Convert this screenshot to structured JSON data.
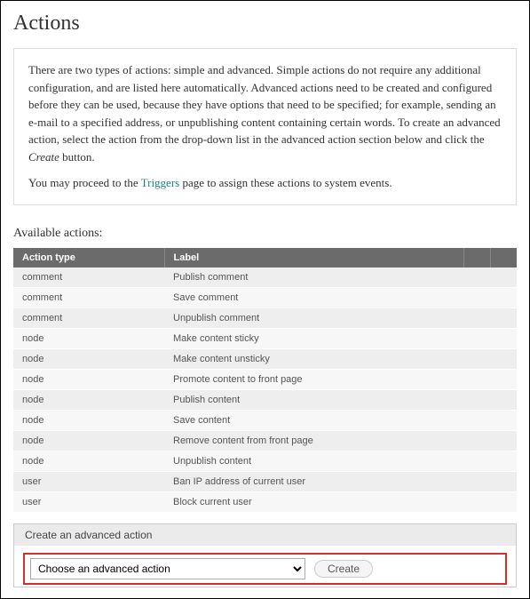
{
  "page": {
    "title": "Actions"
  },
  "info": {
    "paragraph1_a": "There are two types of actions: simple and advanced. Simple actions do not require any additional configuration, and are listed here automatically. Advanced actions need to be created and configured before they can be used, because they have options that need to be specified; for example, sending an e-mail to a specified address, or unpublishing content containing certain words. To create an advanced action, select the action from the drop-down list in the advanced action section below and click the ",
    "paragraph1_em": "Create",
    "paragraph1_b": " button.",
    "paragraph2_a": "You may proceed to the ",
    "triggers_link": "Triggers",
    "paragraph2_b": " page to assign these actions to system events."
  },
  "available_label": "Available actions:",
  "table": {
    "headers": {
      "type": "Action type",
      "label": "Label"
    },
    "rows": [
      {
        "type": "comment",
        "label": "Publish comment"
      },
      {
        "type": "comment",
        "label": "Save comment"
      },
      {
        "type": "comment",
        "label": "Unpublish comment"
      },
      {
        "type": "node",
        "label": "Make content sticky"
      },
      {
        "type": "node",
        "label": "Make content unsticky"
      },
      {
        "type": "node",
        "label": "Promote content to front page"
      },
      {
        "type": "node",
        "label": "Publish content"
      },
      {
        "type": "node",
        "label": "Save content"
      },
      {
        "type": "node",
        "label": "Remove content from front page"
      },
      {
        "type": "node",
        "label": "Unpublish content"
      },
      {
        "type": "user",
        "label": "Ban IP address of current user"
      },
      {
        "type": "user",
        "label": "Block current user"
      }
    ]
  },
  "advanced": {
    "header": "Create an advanced action",
    "select_placeholder": "Choose an advanced action",
    "create_button": "Create"
  }
}
